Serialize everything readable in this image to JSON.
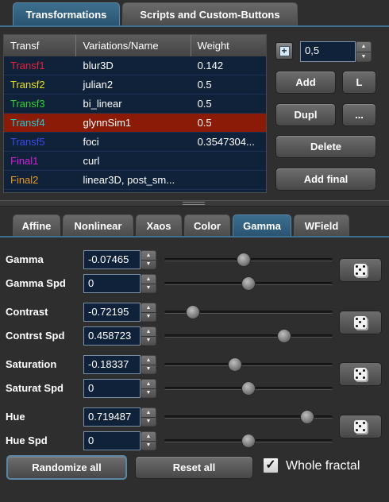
{
  "top_tabs": [
    "Transformations",
    "Scripts and Custom-Buttons"
  ],
  "table": {
    "headers": [
      "Transf",
      "Variations/Name",
      "Weight"
    ],
    "rows": [
      {
        "name": "Transf1",
        "variation": "blur3D",
        "weight": "0.142",
        "color": "#e8203a"
      },
      {
        "name": "Transf2",
        "variation": "julian2",
        "weight": "0.5",
        "color": "#e8e020"
      },
      {
        "name": "Transf3",
        "variation": "bi_linear",
        "weight": "0.5",
        "color": "#30d030"
      },
      {
        "name": "Transf4",
        "variation": "glynnSim1",
        "weight": "0.5",
        "color": "#20c8d8"
      },
      {
        "name": "Transf5",
        "variation": "foci",
        "weight": "0.3547304...",
        "color": "#3a4ae8"
      },
      {
        "name": "Final1",
        "variation": "curl",
        "weight": "",
        "color": "#d020d8"
      },
      {
        "name": "Final2",
        "variation": "linear3D, post_sm...",
        "weight": "",
        "color": "#e89a20"
      }
    ]
  },
  "weight_spinner": {
    "value": "0,5",
    "icon": "plus-icon"
  },
  "buttons": {
    "add": "Add",
    "l": "L",
    "dupl": "Dupl",
    "more": "...",
    "delete": "Delete",
    "add_final": "Add final"
  },
  "sub_tabs": [
    "Affine",
    "Nonlinear",
    "Xaos",
    "Color",
    "Gamma",
    "WField"
  ],
  "gamma": {
    "gamma": {
      "label": "Gamma",
      "value": "-0.07465",
      "slider": 0.47
    },
    "gamma_spd": {
      "label": "Gamma Spd",
      "value": "0",
      "slider": 0.5
    },
    "contrast": {
      "label": "Contrast",
      "value": "-0.72195",
      "slider": 0.17
    },
    "contrast_spd": {
      "label": "Contrst Spd",
      "value": "0.458723",
      "slider": 0.71
    },
    "saturation": {
      "label": "Saturation",
      "value": "-0.18337",
      "slider": 0.42
    },
    "saturation_spd": {
      "label": "Saturat Spd",
      "value": "0",
      "slider": 0.5
    },
    "hue": {
      "label": "Hue",
      "value": "0.719487",
      "slider": 0.85
    },
    "hue_spd": {
      "label": "Hue Spd",
      "value": "0",
      "slider": 0.5
    }
  },
  "bottom": {
    "randomize": "Randomize all",
    "reset": "Reset all",
    "whole_fractal": "Whole fractal",
    "whole_fractal_checked": true
  },
  "colors": {
    "accent": "#3d6f8e",
    "selected_row": "#8b1a06",
    "field_bg": "#10223a"
  }
}
